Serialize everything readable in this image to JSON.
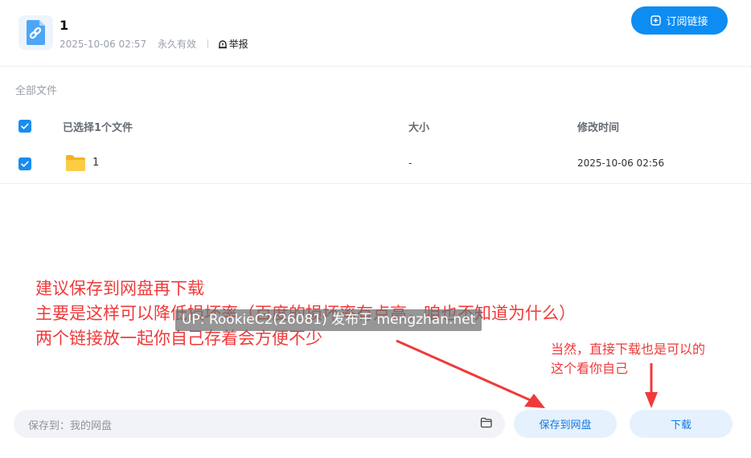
{
  "header": {
    "title": "1",
    "date": "2025-10-06 02:57",
    "validity": "永久有效",
    "report_label": "举报",
    "subscribe_label": "订阅链接"
  },
  "breadcrumb": {
    "label": "全部文件"
  },
  "table": {
    "selected_label": "已选择1个文件",
    "col_size": "大小",
    "col_modified": "修改时间",
    "rows": [
      {
        "name": "1",
        "size": "-",
        "modified": "2025-10-06 02:56",
        "checked": true
      }
    ]
  },
  "annotation": {
    "line1": "建议保存到网盘再下载",
    "line2": "主要是这样可以降低损坏率（百度的损坏率有点高，咱也不知道为什么）",
    "line3": "两个链接放一起你自己存着会方便不少",
    "side1": "当然，直接下载也是可以的",
    "side2": "这个看你自己"
  },
  "watermark": {
    "text": "UP: RookieC2(26081) 发布于 mengzhan.net"
  },
  "footer": {
    "save_path_label": "保存到：我的网盘",
    "save_button": "保存到网盘",
    "download_button": "下载"
  },
  "colors": {
    "accent": "#0d8cf2",
    "annotation": "#f03a3a",
    "folder": "#f7c13a"
  }
}
